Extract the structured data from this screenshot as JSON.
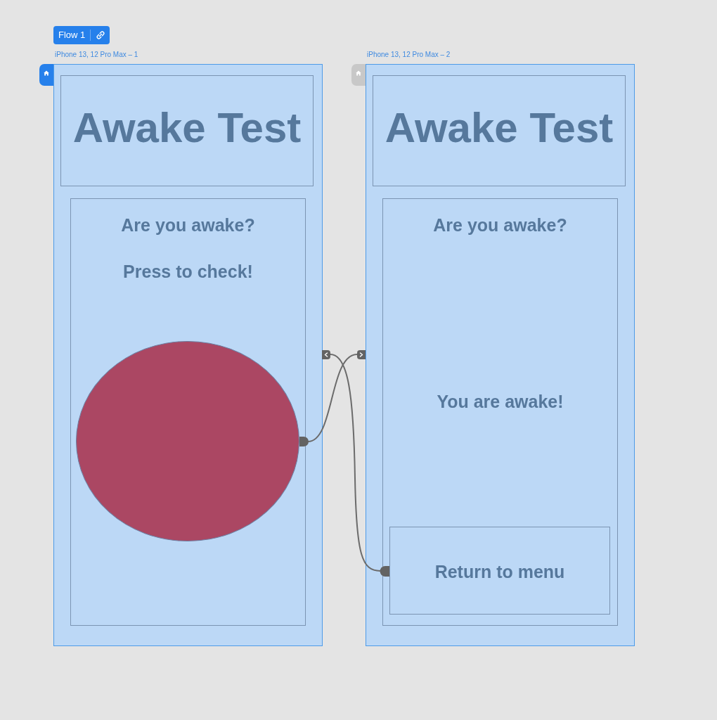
{
  "flow": {
    "label": "Flow 1"
  },
  "artboards": [
    {
      "label": "iPhone 13, 12 Pro Max – 1",
      "home": true,
      "title": "Awake Test",
      "items": [
        {
          "kind": "heading",
          "text": "Are you awake?"
        },
        {
          "kind": "prompt",
          "text": "Press to check!"
        },
        {
          "kind": "ellipse"
        }
      ]
    },
    {
      "label": "iPhone 13, 12 Pro Max – 2",
      "home": false,
      "title": "Awake Test",
      "items": [
        {
          "kind": "heading",
          "text": "Are you awake?"
        },
        {
          "kind": "message",
          "text": "You are awake!"
        },
        {
          "kind": "button",
          "text": "Return to menu"
        }
      ]
    }
  ]
}
